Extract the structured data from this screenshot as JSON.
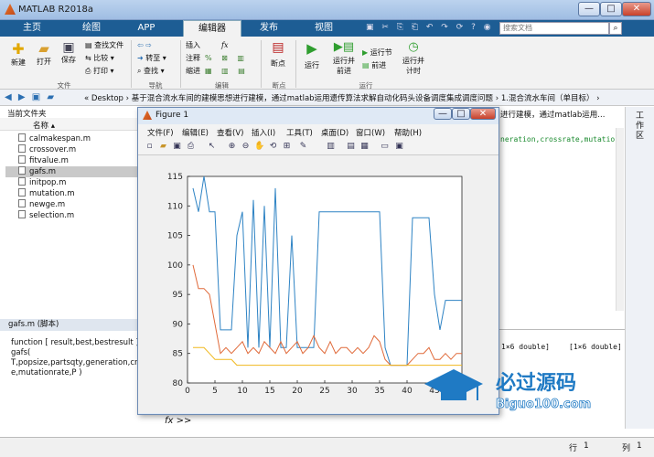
{
  "window": {
    "title": "MATLAB R2018a",
    "min": "—",
    "max": "□",
    "close": "✕"
  },
  "tabs": [
    "主页",
    "绘图",
    "APP",
    "编辑器",
    "发布",
    "视图"
  ],
  "search": {
    "placeholder": "搜索文档"
  },
  "ribbon": {
    "new": "新建",
    "open": "打开",
    "save": "保存",
    "find_file": "查找文件",
    "compare": "比较",
    "print": "打印",
    "goto": "转至",
    "find": "查找",
    "insert": "插入",
    "comment": "注释",
    "indent": "缩进",
    "fx": "fx",
    "breakpoint": "断点",
    "run": "运行",
    "run_advance_l1": "运行并",
    "run_advance_l2": "前进",
    "run_section": "运行节",
    "advance": "前进",
    "run_time_l1": "运行并",
    "run_time_l2": "计时",
    "sections": [
      "文件",
      "导航",
      "编辑",
      "断点",
      "运行"
    ]
  },
  "address": {
    "path": "« Desktop  ›  基于混合流水车间的建模思想进行建模，通过matlab运用遗传算法求解自动化码头设备调度集成调度问题  ›  1.混合流水车间（单目标）  ›"
  },
  "file_panel": {
    "title": "当前文件夹",
    "col_name": "名称",
    "files": [
      "calmakespan.m",
      "crossover.m",
      "fitvalue.m",
      "gafs.m",
      "initpop.m",
      "mutation.m",
      "newge.m",
      "selection.m"
    ]
  },
  "detail": {
    "title": "gafs.m  (脚本)",
    "text": "function [ result,best,bestresult ] =\ngafs(\nT,popsize,partsqty,generation,cros\ne,mutationrate,P )"
  },
  "editor": {
    "line1": "进行建模，通过matlab运用...",
    "line2": "neration,crossrate,mutatio"
  },
  "workspace": {
    "v1": "1×6 double]",
    "v2": "[1×6 double]"
  },
  "command": {
    "prompt": "fx >>"
  },
  "right_panel": {
    "label": "工作区"
  },
  "status": {
    "row_label": "行",
    "row": "1",
    "col_label": "列",
    "col": "1"
  },
  "figure": {
    "title": "Figure 1",
    "min": "—",
    "max": "□",
    "close": "✕",
    "menu": [
      "文件(F)",
      "编辑(E)",
      "查看(V)",
      "插入(I)",
      "工具(T)",
      "桌面(D)",
      "窗口(W)",
      "帮助(H)"
    ]
  },
  "watermark": {
    "cn": "必过源码",
    "en": "Biguo100.com"
  },
  "colors": {
    "series1": "#2e83c4",
    "series2": "#e06a3a",
    "series3": "#f0b81e",
    "ribbon_tab": "#1d5d94"
  },
  "chart_data": {
    "type": "line",
    "xlim": [
      0,
      50
    ],
    "ylim": [
      80,
      115
    ],
    "xticks": [
      0,
      5,
      10,
      15,
      20,
      25,
      30,
      35,
      40,
      45,
      50
    ],
    "yticks": [
      80,
      85,
      90,
      95,
      100,
      105,
      110,
      115
    ],
    "grid": false,
    "series": [
      {
        "x": [
          1,
          2,
          3,
          4,
          5,
          6,
          7,
          8,
          9,
          10,
          11,
          12,
          13,
          14,
          15,
          16,
          17,
          18,
          19,
          20,
          21,
          22,
          23,
          24,
          25,
          26,
          27,
          28,
          29,
          30,
          31,
          32,
          33,
          34,
          35,
          36,
          37,
          38,
          39,
          40,
          41,
          42,
          43,
          44,
          45,
          46,
          47,
          48,
          49,
          50
        ],
        "values": [
          113,
          109,
          115,
          109,
          109,
          89,
          89,
          89,
          105,
          109,
          86,
          111,
          86,
          110,
          86,
          113,
          86,
          86,
          105,
          86,
          86,
          86,
          86,
          109,
          109,
          109,
          109,
          109,
          109,
          109,
          109,
          109,
          109,
          109,
          109,
          86,
          83,
          83,
          83,
          83,
          108,
          108,
          108,
          108,
          95,
          89,
          94,
          94,
          94,
          94
        ]
      },
      {
        "x": [
          1,
          2,
          3,
          4,
          5,
          6,
          7,
          8,
          9,
          10,
          11,
          12,
          13,
          14,
          15,
          16,
          17,
          18,
          19,
          20,
          21,
          22,
          23,
          24,
          25,
          26,
          27,
          28,
          29,
          30,
          31,
          32,
          33,
          34,
          35,
          36,
          37,
          38,
          39,
          40,
          41,
          42,
          43,
          44,
          45,
          46,
          47,
          48,
          49,
          50
        ],
        "values": [
          100,
          96,
          96,
          95,
          90,
          85,
          86,
          85,
          86,
          87,
          85,
          86,
          85,
          87,
          86,
          85,
          87,
          85,
          86,
          87,
          85,
          86,
          88,
          86,
          85,
          87,
          85,
          86,
          86,
          85,
          86,
          85,
          86,
          88,
          87,
          84,
          83,
          83,
          83,
          83,
          84,
          85,
          85,
          86,
          84,
          84,
          85,
          84,
          85,
          85
        ]
      },
      {
        "x": [
          1,
          2,
          3,
          4,
          5,
          6,
          7,
          8,
          9,
          10,
          11,
          12,
          13,
          14,
          15,
          16,
          17,
          18,
          19,
          20,
          21,
          22,
          23,
          24,
          25,
          26,
          27,
          28,
          29,
          30,
          31,
          32,
          33,
          34,
          35,
          36,
          37,
          38,
          39,
          40,
          41,
          42,
          43,
          44,
          45,
          46,
          47,
          48,
          49,
          50
        ],
        "values": [
          86,
          86,
          86,
          85,
          84,
          84,
          84,
          84,
          83,
          83,
          83,
          83,
          83,
          83,
          83,
          83,
          83,
          83,
          83,
          83,
          83,
          83,
          83,
          83,
          83,
          83,
          83,
          83,
          83,
          83,
          83,
          83,
          83,
          83,
          83,
          83,
          83,
          83,
          83,
          83,
          83,
          83,
          83,
          83,
          83,
          83,
          83,
          83,
          83,
          83
        ]
      }
    ]
  }
}
